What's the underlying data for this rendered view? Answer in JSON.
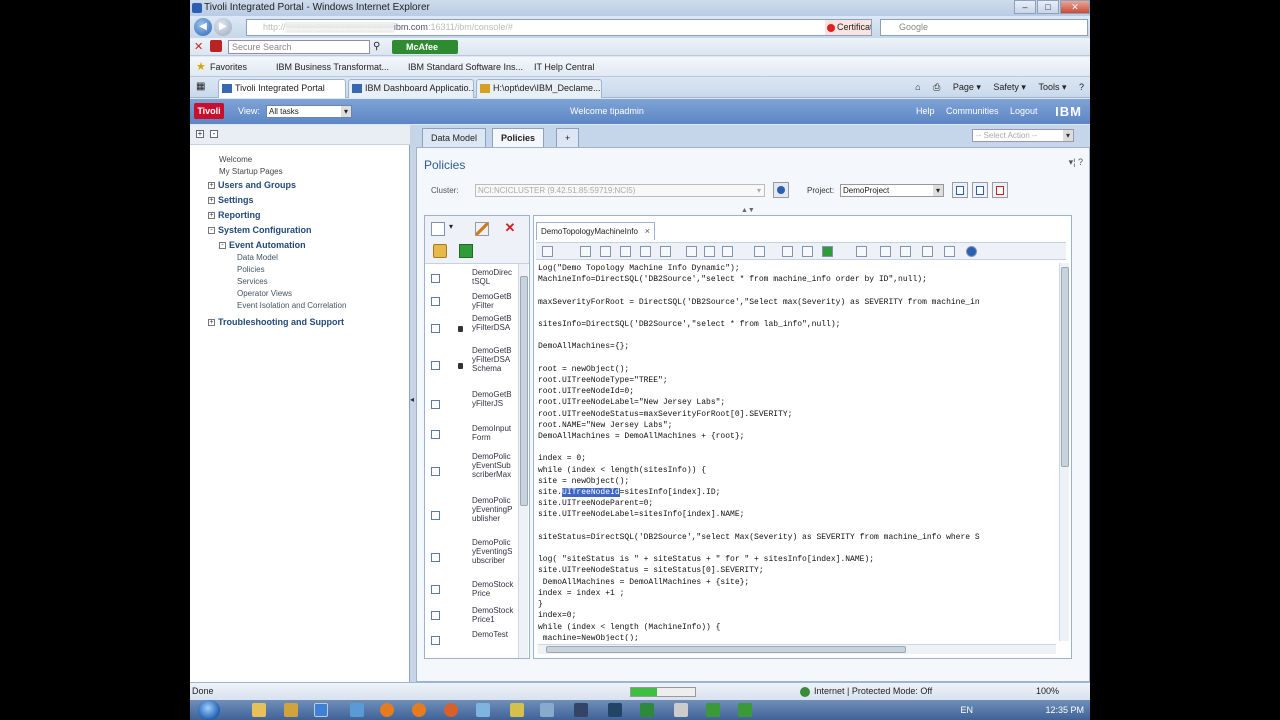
{
  "browser": {
    "title": "Tivoli Integrated Portal - Windows Internet Explorer",
    "address_prefix": "http://",
    "address_host": "ibm.com",
    "address_rest": ":16311/ibm/console/#",
    "cert_error": "Certificate Error",
    "search_engine": "Google",
    "secure_search_placeholder": "Secure Search",
    "mcafee_label": "McAfee",
    "favorites_label": "Favorites",
    "favorites": [
      "IBM Business Transformat...",
      "IBM Standard Software Ins...",
      "IT Help Central"
    ],
    "tabs": [
      "Tivoli Integrated Portal",
      "IBM Dashboard Applicatio...",
      "H:\\opt\\dev\\IBM_Declame..."
    ],
    "commands": [
      "Page ▾",
      "Safety ▾",
      "Tools ▾"
    ],
    "status_text": "Done",
    "zone_text": "Internet | Protected Mode: Off",
    "zoom": "100%",
    "load_progress": 0.4
  },
  "portal": {
    "logo": "Tivoli",
    "view_label": "View:",
    "view_value": "All tasks",
    "welcome": "Welcome  tipadmin",
    "links": [
      "Help",
      "Communities",
      "Logout"
    ],
    "brand": "IBM"
  },
  "nav": {
    "items": [
      {
        "label": "Welcome"
      },
      {
        "label": "My Startup Pages"
      },
      {
        "label": "Users and Groups"
      },
      {
        "label": "Settings"
      },
      {
        "label": "Reporting"
      },
      {
        "label": "System Configuration"
      },
      {
        "label": "Event Automation"
      },
      {
        "label": "Data Model"
      },
      {
        "label": "Policies"
      },
      {
        "label": "Services"
      },
      {
        "label": "Operator Views"
      },
      {
        "label": "Event Isolation and Correlation"
      },
      {
        "label": "Troubleshooting and Support"
      }
    ]
  },
  "main": {
    "tabs": [
      "Data Model",
      "Policies",
      "+"
    ],
    "action_placeholder": "-- Select Action --",
    "portlet_title": "Policies",
    "cluster_label": "Cluster:",
    "cluster_value": "NCI:NCICLUSTER (9.42.51.85:59719:NCI5)",
    "project_label": "Project:",
    "project_value": "DemoProject"
  },
  "policies": [
    "DemoDirectSQL",
    "DemoGetByFilter",
    "DemoGetByFilterDSA",
    "DemoGetByFilterDSASchema",
    "DemoGetByFilterJS",
    "DemoInputForm",
    "DemoPolicyEventSubscriberMax",
    "DemoPolicyEventingPublisher",
    "DemoPolicyEventingSubscriber",
    "DemoStockPrice",
    "DemoStockPrice1",
    "DemoTest"
  ],
  "editor": {
    "tab_label": "DemoTopologyMachineInfo",
    "close_glyph": "×",
    "code_lines": [
      "Log(\"Demo Topology Machine Info Dynamic\");",
      "MachineInfo=DirectSQL('DB2Source',\"select * from machine_info order by ID\",null);",
      "",
      "maxSeverityForRoot = DirectSQL('DB2Source',\"Select max(Severity) as SEVERITY from machine_in",
      "",
      "sitesInfo=DirectSQL('DB2Source',\"select * from lab_info\",null);",
      "",
      "DemoAllMachines={};",
      "",
      "root = newObject();",
      "root.UITreeNodeType=\"TREE\";",
      "root.UITreeNodeId=0;",
      "root.UITreeNodeLabel=\"New Jersey Labs\";",
      "root.UITreeNodeStatus=maxSeverityForRoot[0].SEVERITY;",
      "root.NAME=\"New Jersey Labs\";",
      "DemoAllMachines = DemoAllMachines + {root};",
      "",
      "index = 0;",
      "while (index < length(sitesInfo)) {",
      "site = newObject();",
      "site.",
      "site.UITreeNodeParent=0;",
      "site.UITreeNodeLabel=sitesInfo[index].NAME;",
      "",
      "siteStatus=DirectSQL('DB2Source',\"select Max(Severity) as SEVERITY from machine_info where S",
      "",
      "log( \"siteStatus is \" + siteStatus + \" for \" + sitesInfo[index].NAME);",
      "site.UITreeNodeStatus = siteStatus[0].SEVERITY;",
      " DemoAllMachines = DemoAllMachines + {site};",
      "index = index +1 ;",
      "}",
      "index=0;",
      "while (index < length (MachineInfo)) {",
      " machine=NewObject();"
    ],
    "highlight_word": "UITreeNodeId",
    "highlight_rest": "=sitesInfo[index].ID;"
  },
  "taskbar": {
    "lang": "EN",
    "time": "12:35 PM"
  }
}
